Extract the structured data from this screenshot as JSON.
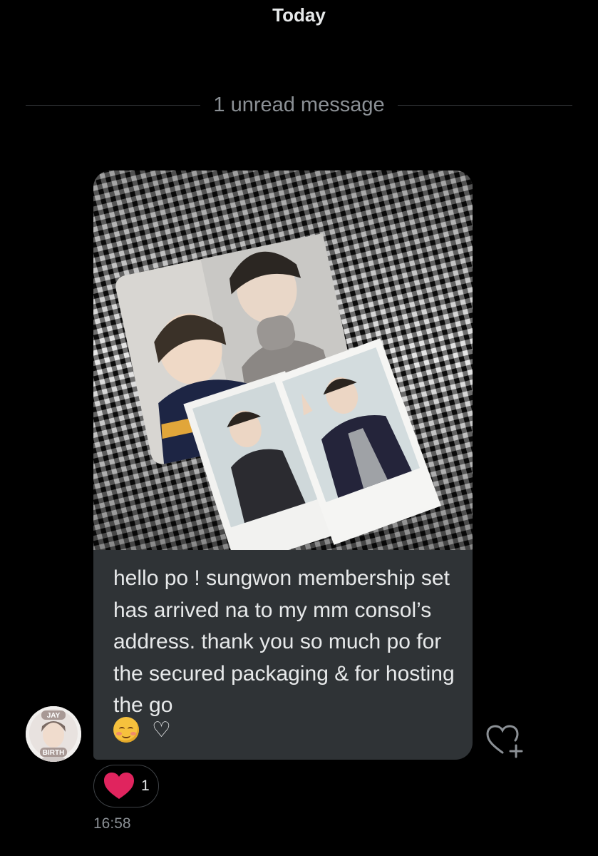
{
  "conversation": {
    "date_separator": "Today",
    "unread_divider": "1 unread message"
  },
  "message": {
    "image_alt": "photo cards on gingham cloth",
    "text": "hello po ! sungwon membership set has arrived na to my mm consol’s address. thank you so much po for the secured packaging & for hosting the go",
    "emoji_heart": "♡",
    "reaction": {
      "icon": "heart-icon",
      "count": "1",
      "color": "#f91880"
    },
    "timestamp": "16:58"
  },
  "sender": {
    "avatar_top_label": "JAY",
    "avatar_bottom_label": "BIRTH"
  },
  "colors": {
    "background": "#000000",
    "bubble": "#2f3336",
    "primary_text": "#e7e9ea",
    "secondary_text": "#8b9095"
  }
}
